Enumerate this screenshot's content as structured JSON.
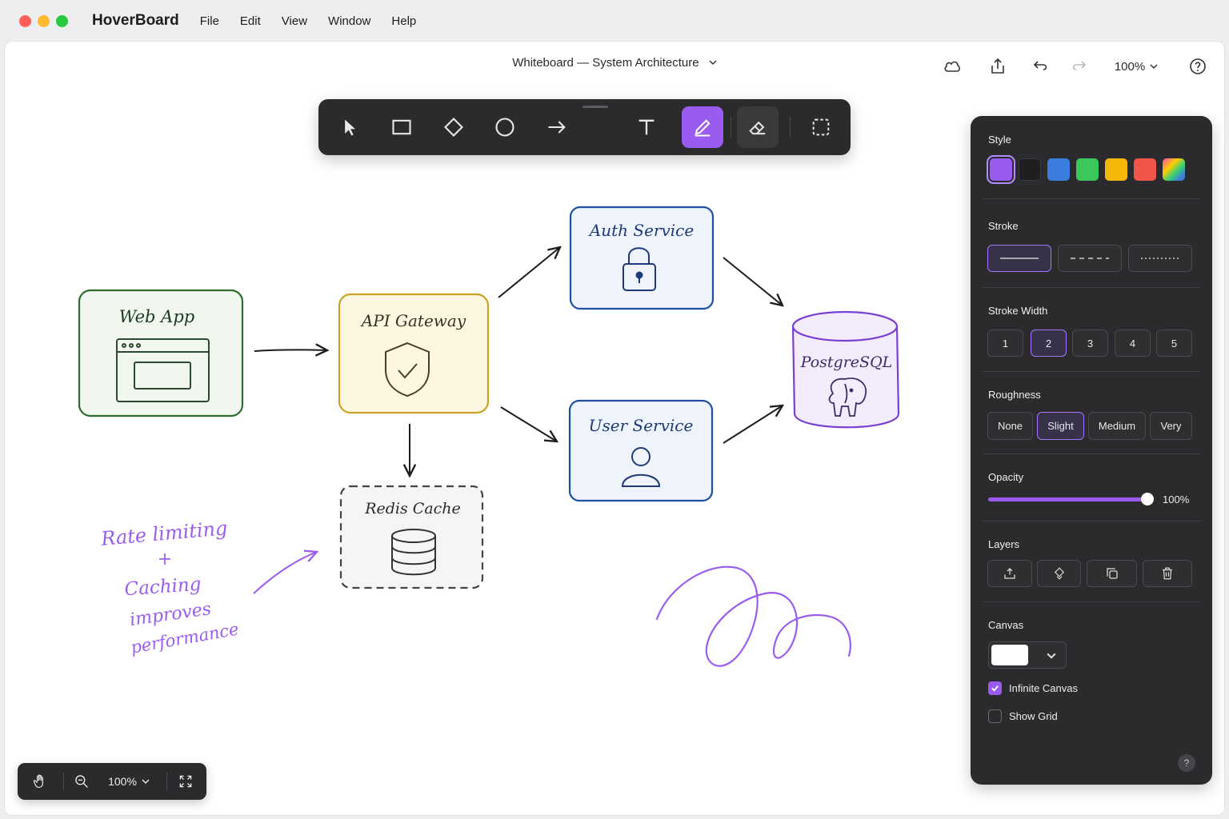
{
  "menubar": {
    "app_name": "HoverBoard",
    "traffic_colors": [
      "#fe5f57",
      "#febc2e",
      "#28c840"
    ],
    "items": [
      "File",
      "Edit",
      "View",
      "Window",
      "Help"
    ]
  },
  "document": {
    "title": "Whiteboard — System Architecture"
  },
  "top_actions": {
    "icons": [
      "cloud-icon",
      "share-icon",
      "undo-icon",
      "redo-icon",
      "help-icon"
    ],
    "zoom": "100%"
  },
  "toolbar": {
    "tools": [
      "select",
      "rectangle",
      "diamond",
      "ellipse",
      "arrow",
      "text",
      "pen",
      "eraser",
      "lasso"
    ],
    "active_tool": "pen",
    "accent": "#9a5cf0"
  },
  "diagram": {
    "nodes": {
      "web_app": "Web App",
      "api_gateway": "API Gateway",
      "auth_service": "Auth Service",
      "user_service": "User Service",
      "postgres": "PostgreSQL",
      "redis": "Redis Cache"
    },
    "annotation": [
      "Rate limiting",
      "+",
      "Caching",
      "improves",
      "performance"
    ],
    "colors": {
      "web_app": "#2e6b2e",
      "api_gateway": "#c9a227",
      "service": "#1e4fa0",
      "postgres": "#7b3fd1",
      "redis": "#444444",
      "annotation": "#9a5cf0"
    }
  },
  "panel": {
    "style_label": "Style",
    "colors": [
      "#9a5cf0",
      "#1f1f21",
      "#3b7ddd",
      "#3cc75a",
      "#f5b80a",
      "#f0554a",
      "gradient"
    ],
    "selected_color": 0,
    "stroke_label": "Stroke",
    "stroke_options": [
      "solid",
      "dashed",
      "dotted"
    ],
    "selected_stroke": 0,
    "stroke_width_label": "Stroke Width",
    "stroke_widths": [
      "1",
      "2",
      "3",
      "4",
      "5"
    ],
    "selected_width": 1,
    "roughness_label": "Roughness",
    "roughness": [
      "None",
      "Slight",
      "Medium",
      "Very"
    ],
    "selected_roughness": 1,
    "opacity_label": "Opacity",
    "opacity_value": "100%",
    "opacity": 1.0,
    "layers_label": "Layers",
    "layer_icons": [
      "bring-front-icon",
      "arrange-icon",
      "duplicate-icon",
      "delete-icon"
    ],
    "canvas_label": "Canvas",
    "canvas_color": "#ffffff",
    "infinite_canvas": "Infinite Canvas",
    "infinite_checked": true,
    "show_grid": "Show Grid",
    "grid_checked": false,
    "help": "?"
  },
  "zoombar": {
    "zoom": "100%"
  }
}
